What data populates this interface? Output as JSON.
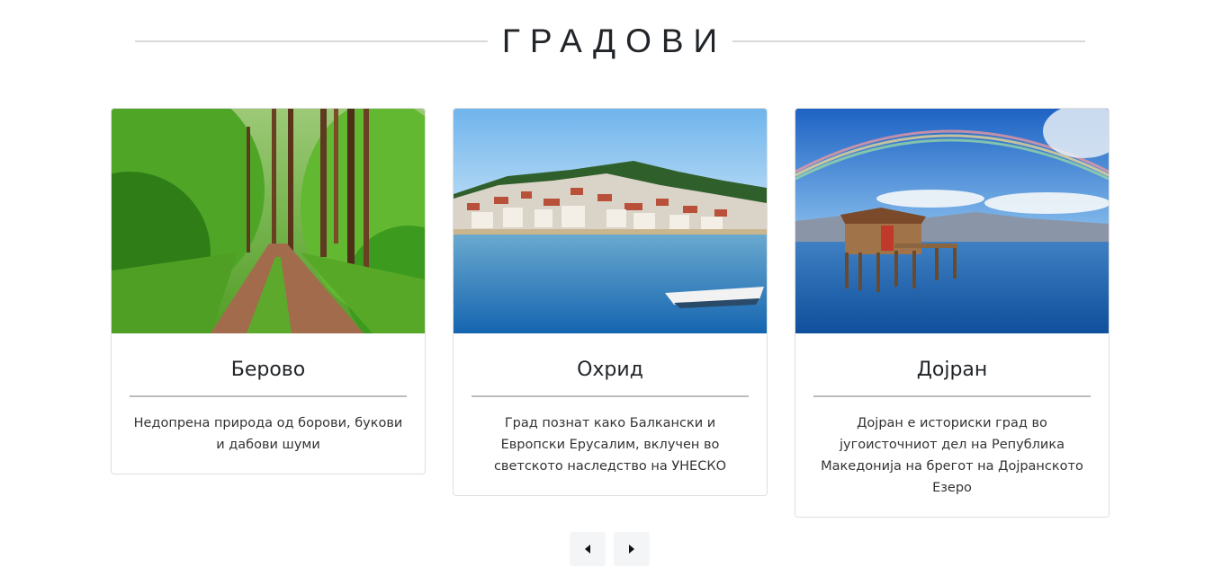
{
  "section": {
    "title": "ГРАДОВИ"
  },
  "cards": [
    {
      "title": "Берово",
      "description": "Недопрена природа од борови, букови и дабови шуми"
    },
    {
      "title": "Охрид",
      "description": "Град познат како Балкански и Европски Ерусалим, вклучен во светското наследство на УНЕСКО"
    },
    {
      "title": "Дојран",
      "description": "Дојран е историски град во југоисточниот дел на Република Македонија на брегот на Дојранското Езеро"
    }
  ],
  "carousel": {
    "prev_icon": "caret-left-icon",
    "next_icon": "caret-right-icon"
  },
  "colors": {
    "divider": "#d9d9d9",
    "button_bg": "#f4f5f7",
    "text": "#212529"
  }
}
